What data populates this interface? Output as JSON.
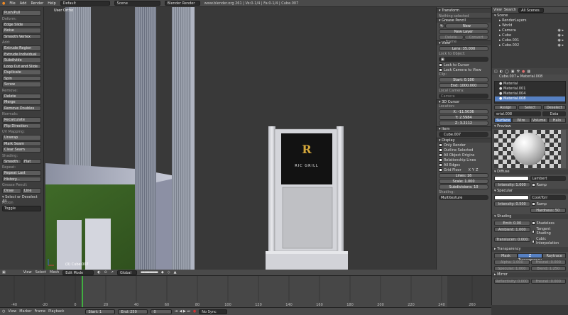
{
  "topbar": {
    "menus": [
      "File",
      "Add",
      "Render",
      "Help"
    ],
    "layout": "Default",
    "scene": "Scene",
    "engine": "Blender Render",
    "stats": "www.blender.org 261 | Ve:0-1/4 | Fa:0-1/4 | Cube.007"
  },
  "tools": {
    "buttons_a": [
      "Push/Pull"
    ],
    "deform_hdr": "Deform:",
    "buttons_b": [
      "Edge Slide",
      "Noise",
      "Smooth Vertex"
    ],
    "add_hdr": "Add:",
    "buttons_c": [
      "Extrude Region",
      "Extrude Individual",
      "Subdivide",
      "Loop Cut and Slide",
      "Duplicate",
      "Spin",
      "Screw"
    ],
    "remove_hdr": "Remove:",
    "buttons_d": [
      "Delete",
      "Merge",
      "Remove Doubles"
    ],
    "normals_hdr": "Normals:",
    "buttons_e": [
      "Recalculate",
      "Flip Direction"
    ],
    "uv_hdr": "UV Mapping:",
    "buttons_f": [
      "Unwrap",
      "Mark Seam",
      "Clear Seam"
    ],
    "shading_hdr": "Shading:",
    "smooth": "Smooth",
    "flat": "Flat",
    "repeat_hdr": "Repeat:",
    "buttons_g": [
      "Repeat Last",
      "History..."
    ],
    "grease_hdr": "Grease Pencil:",
    "draw": "Draw",
    "line": "Line",
    "op_hdr": "▾ Select or Deselect All",
    "action_lbl": "Action",
    "action_val": "Toggle"
  },
  "viewport": {
    "label": "User Ortho",
    "object": "(0) Cube.007",
    "sign_text": "RIC GRILL",
    "mode": "Edit Mode",
    "orientation": "Global"
  },
  "npanel": {
    "transform_hdr": "▾ Transform",
    "nothing_selected": "Nothing selected",
    "grease_hdr": "▾ Grease Pencil",
    "new": "New",
    "new_layer": "New Layer",
    "delete_frame": "Delete Frame",
    "convert": "Convert",
    "view_hdr": "▾ View",
    "lens": "Lens: 35.000",
    "lock_obj": "Lock to Object:",
    "lock_cursor": "Lock to Cursor",
    "lock_camera": "Lock Camera to View",
    "clip": "Clip:",
    "start": "Start: 0.100",
    "end": "End: 1000.000",
    "local_camera": "Local Camera:",
    "camera": "Camera",
    "cursor_hdr": "▾ 3D Cursor",
    "location": "Location:",
    "cx": "X: -11.5036",
    "cy": "Y: 2.5984",
    "cz": "Z: 3.2112",
    "item_hdr": "▾ Item",
    "item_name": "Cube.007",
    "display_hdr": "▾ Display",
    "only_render": "Only Render",
    "outline_selected": "Outline Selected",
    "all_origins": "All Object Origins",
    "rel_lines": "Relationship Lines",
    "all_edges": "All Edges",
    "grid_floor": "Grid Floor",
    "axes": [
      "X",
      "Y",
      "Z"
    ],
    "lines": "Lines: 16",
    "scale": "Scale: 1.000",
    "subdiv": "Subdivisions: 10",
    "shading": "Shading:",
    "multitexture": "Multitexture"
  },
  "outliner": {
    "view": "View",
    "search": "Search",
    "all_scenes": "All Scenes",
    "items": [
      "Scene",
      "RenderLayers",
      "World",
      "Camera",
      "Cube",
      "Cube.001",
      "Cube.002"
    ]
  },
  "props": {
    "breadcrumb": "Cube.007 ▸ Material.008",
    "materials": [
      "Material",
      "Material.001",
      "Material.004",
      "Material.008"
    ],
    "assign": "Assign",
    "select": "Select",
    "deselect": "Deselect",
    "mat_name": "erial.008",
    "data": "Data",
    "tabs": [
      "Surface",
      "Wire",
      "Volume",
      "Halo"
    ],
    "preview_hdr": "▾ Preview",
    "diffuse_hdr": "▾ Diffuse",
    "lambert": "Lambert",
    "intensity_d": "Intensity: 1.000",
    "ramp": "Ramp",
    "specular_hdr": "▾ Specular",
    "cooktorr": "CookTorr",
    "intensity_s": "Intensity: 0.500",
    "hardness": "Hardness: 50",
    "shading_hdr": "▾ Shading",
    "emit": "Emit: 0.00",
    "ambient": "Ambient: 1.000",
    "translucency": "Translucen: 0.000",
    "shadeless": "Shadeless",
    "tangent": "Tangent Shading",
    "cubic": "Cubic Interpolation",
    "transparency_hdr": "▸ Transparency",
    "mask": "Mask",
    "ztransp": "Z Transparency",
    "raytrace": "Raytrace",
    "alpha": "Alpha: 1.000",
    "fresnel": "Fresnel: 0.000",
    "specular_v": "Specular: 1.000",
    "blend": "Blend: 1.250",
    "mirror_hdr": "▸ Mirror",
    "reflectivity": "Reflectivity: 0.000",
    "fresnel2": "Fresnel: 0.000"
  },
  "timeline": {
    "menus": [
      "View",
      "Marker",
      "Frame",
      "Playback"
    ],
    "start": "Start: 1",
    "end": "End: 250",
    "frame": "0",
    "sync": "No Sync",
    "ticks": [
      "-40",
      "-20",
      "0",
      "20",
      "40",
      "60",
      "80",
      "100",
      "120",
      "140",
      "160",
      "180",
      "200",
      "220",
      "240",
      "260"
    ]
  }
}
